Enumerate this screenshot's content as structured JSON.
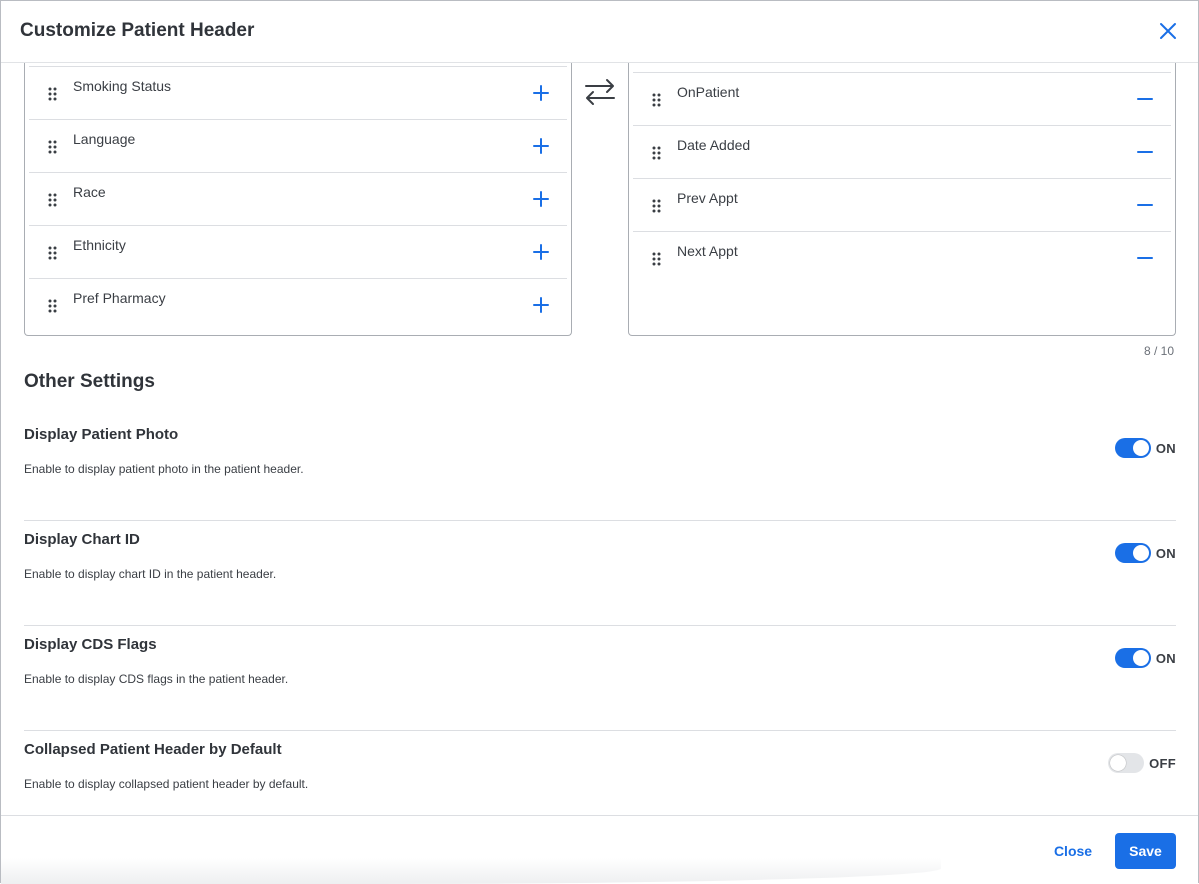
{
  "dialog": {
    "title": "Customize Patient Header"
  },
  "available_fields": [
    {
      "label": "Smoking Status",
      "action_icon": "plus-icon"
    },
    {
      "label": "Language",
      "action_icon": "plus-icon"
    },
    {
      "label": "Race",
      "action_icon": "plus-icon"
    },
    {
      "label": "Ethnicity",
      "action_icon": "plus-icon"
    },
    {
      "label": "Pref Pharmacy",
      "action_icon": "plus-icon"
    }
  ],
  "selected_fields": [
    {
      "label": "OnPatient",
      "action_icon": "minus-icon"
    },
    {
      "label": "Date Added",
      "action_icon": "minus-icon"
    },
    {
      "label": "Prev Appt",
      "action_icon": "minus-icon"
    },
    {
      "label": "Next Appt",
      "action_icon": "minus-icon"
    }
  ],
  "selected_count": "8 / 10",
  "other_settings": {
    "title": "Other Settings",
    "items": [
      {
        "title": "Display Patient Photo",
        "description": "Enable to display patient photo in the patient header.",
        "enabled": true,
        "state_label": "ON"
      },
      {
        "title": "Display Chart ID",
        "description": "Enable to display chart ID in the patient header.",
        "enabled": true,
        "state_label": "ON"
      },
      {
        "title": "Display CDS Flags",
        "description": "Enable to display CDS flags in the patient header.",
        "enabled": true,
        "state_label": "ON"
      },
      {
        "title": "Collapsed Patient Header by Default",
        "description": "Enable to display collapsed patient header by default.",
        "enabled": false,
        "state_label": "OFF"
      }
    ]
  },
  "footer": {
    "close_label": "Close",
    "save_label": "Save"
  },
  "colors": {
    "accent": "#1a6fe6",
    "toggle_off": "#e3e5e8"
  }
}
